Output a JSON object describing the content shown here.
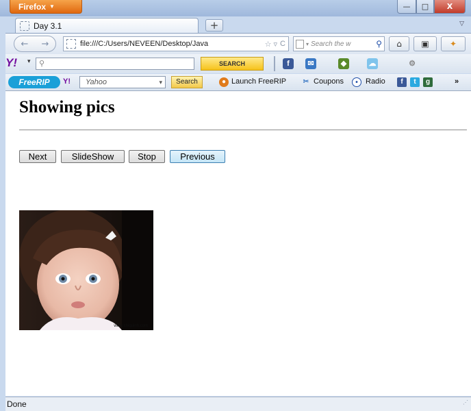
{
  "browser": {
    "app_button": "Firefox",
    "window_controls": {
      "minimize": "—",
      "maximize": "□",
      "close": "X"
    },
    "tab": {
      "title": "Day 3.1"
    },
    "new_tab": "+",
    "tab_list": "▽",
    "nav": {
      "back": "←",
      "forward": "→",
      "url": "file:///C:/Users/NEVEEN/Desktop/Java",
      "search_placeholder": "Search the w",
      "home": "⌂"
    },
    "yahoo_toolbar": {
      "logo": "Y!",
      "search_placeholder": "",
      "search_button": "SEARCH"
    },
    "freerip_toolbar": {
      "logo": "FreeRIP",
      "yahoo_label": "Y!",
      "search_value": "Yahoo",
      "search_button": "Search",
      "launch": "Launch FreeRIP",
      "coupons": "Coupons",
      "radio": "Radio",
      "overflow": "»"
    },
    "status": "Done"
  },
  "page": {
    "heading": "Showing pics",
    "buttons": {
      "next": "Next",
      "slideshow": "SlideShow",
      "stop": "Stop",
      "previous": "Previous"
    },
    "image_credit": "www.chiquinh.com"
  },
  "colors": {
    "firefox_orange": "#e0680f",
    "yahoo_purple": "#720e9e",
    "focus_blue": "#3c7fb1"
  }
}
